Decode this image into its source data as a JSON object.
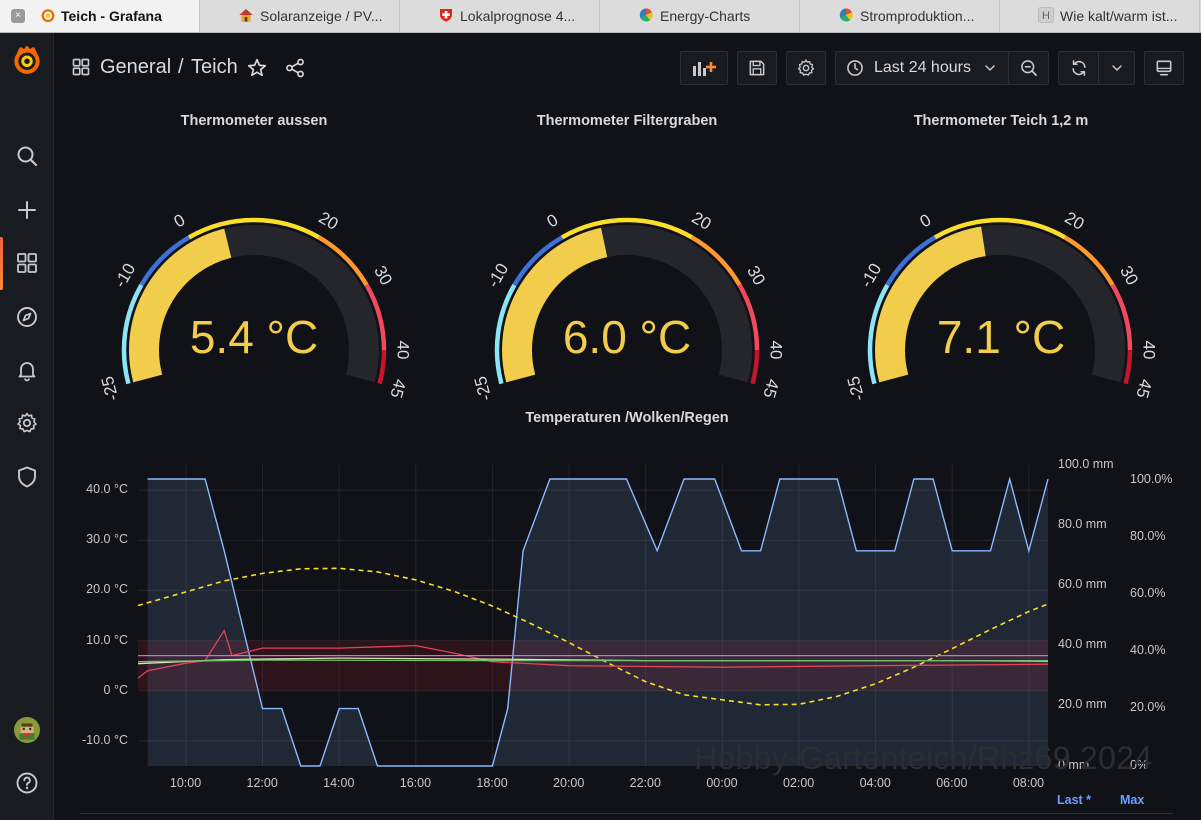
{
  "browser_tabs": [
    {
      "title": "Teich - Grafana",
      "icon": "grafana-icon",
      "active": true
    },
    {
      "title": "Solaranzeige / PV...",
      "icon": "house-icon"
    },
    {
      "title": "Lokalprognose 4...",
      "icon": "swiss-shield-icon"
    },
    {
      "title": "Energy-Charts",
      "icon": "energy-charts-icon"
    },
    {
      "title": "Stromproduktion...",
      "icon": "energy-charts-icon"
    },
    {
      "title": "Wie kalt/warm ist...",
      "icon": "letter-h-icon",
      "icon_text": "H"
    }
  ],
  "sidebar": [
    "grafana-logo-icon",
    "search-icon",
    "plus-icon",
    "dashboards-icon",
    "explore-compass-icon",
    "alerting-bell-icon",
    "settings-gear-icon",
    "shield-icon",
    "user-avatar",
    "help-icon"
  ],
  "breadcrumb": {
    "folder": "General",
    "separator": "/",
    "dashboard": "Teich"
  },
  "toolbar": {
    "time_range": "Last 24 hours"
  },
  "gauges": [
    {
      "title": "Thermometer aussen",
      "value": 5.4,
      "display": "5.4 °C"
    },
    {
      "title": "Thermometer Filtergraben",
      "value": 6.0,
      "display": "6.0 °C"
    },
    {
      "title": "Thermometer Teich 1,2 m",
      "value": 7.1,
      "display": "7.1 °C"
    }
  ],
  "gauge_scale": {
    "min": -25,
    "max": 45,
    "ticks": [
      -25,
      -10,
      0,
      20,
      30,
      40,
      45
    ],
    "thresholds": [
      {
        "from": -25,
        "to": -10,
        "color": "#8ae5f5"
      },
      {
        "from": -10,
        "to": 0,
        "color": "#3d71d9"
      },
      {
        "from": 0,
        "to": 20,
        "color": "#fade2a"
      },
      {
        "from": 20,
        "to": 30,
        "color": "#ff9830"
      },
      {
        "from": 30,
        "to": 40,
        "color": "#f2495c"
      },
      {
        "from": 40,
        "to": 45,
        "color": "#c4162a"
      }
    ],
    "value_color": "#f2cc4b"
  },
  "timeseries": {
    "title": "Temperaturen /Wolken/Regen",
    "left_axis_labels": [
      "40.0 °C",
      "30.0 °C",
      "20.0 °C",
      "10.0 °C",
      "0 °C",
      "-10.0 °C"
    ],
    "right_axis_mm_labels": [
      "100.0 mm",
      "80.0 mm",
      "60.0 mm",
      "40.0 mm",
      "20.0 mm",
      "0 mm"
    ],
    "right_axis_pct_labels": [
      "100.0%",
      "80.0%",
      "60.0%",
      "40.0%",
      "20.0%",
      "0%"
    ],
    "x_labels": [
      "10:00",
      "12:00",
      "14:00",
      "16:00",
      "18:00",
      "20:00",
      "22:00",
      "00:00",
      "02:00",
      "04:00",
      "06:00",
      "08:00"
    ],
    "legend_headers": [
      "Last *",
      "Max"
    ],
    "watermark": "Hobby-Gartenteich/Rhz69 2024"
  },
  "chart_data": {
    "type": "line",
    "title": "Temperaturen /Wolken/Regen",
    "x_unit": "hours (08:45 → 08:45 next day)",
    "x_range": [
      8.75,
      32.5
    ],
    "ylim_left": [
      -15,
      45
    ],
    "ylim_right_pct": [
      0,
      100
    ],
    "ylim_right_mm": [
      0,
      100
    ],
    "grid": true,
    "series": [
      {
        "axis": "right_pct",
        "color": "#8ab8ff",
        "style": "area",
        "points": [
          [
            9,
            100
          ],
          [
            10.5,
            100
          ],
          [
            11,
            75
          ],
          [
            12,
            20
          ],
          [
            12.5,
            20
          ],
          [
            13,
            0
          ],
          [
            13.5,
            0
          ],
          [
            14,
            20
          ],
          [
            14.5,
            20
          ],
          [
            15,
            0
          ],
          [
            18,
            0
          ],
          [
            18.4,
            20
          ],
          [
            18.8,
            75
          ],
          [
            19.5,
            100
          ],
          [
            21.5,
            100
          ],
          [
            22.3,
            75
          ],
          [
            23,
            100
          ],
          [
            23.8,
            100
          ],
          [
            24.5,
            75
          ],
          [
            25,
            75
          ],
          [
            25.5,
            100
          ],
          [
            27,
            100
          ],
          [
            27.5,
            75
          ],
          [
            28.5,
            75
          ],
          [
            29,
            100
          ],
          [
            29.5,
            100
          ],
          [
            30,
            75
          ],
          [
            31,
            75
          ],
          [
            31.5,
            100
          ],
          [
            32,
            75
          ],
          [
            32.5,
            100
          ]
        ]
      },
      {
        "axis": "left",
        "color": "#fade2a",
        "style": "dashed",
        "points": [
          [
            8.75,
            17
          ],
          [
            10,
            19.7
          ],
          [
            11,
            21.9
          ],
          [
            12,
            23.4
          ],
          [
            13,
            24.3
          ],
          [
            14,
            24.4
          ],
          [
            15,
            23.7
          ],
          [
            16,
            22.1
          ],
          [
            17,
            19.8
          ],
          [
            18,
            16.9
          ],
          [
            19,
            13.4
          ],
          [
            20,
            9.6
          ],
          [
            21,
            5.6
          ],
          [
            22,
            1.8
          ],
          [
            23,
            -0.8
          ],
          [
            24,
            -1.8
          ],
          [
            25,
            -2.8
          ],
          [
            26,
            -2.7
          ],
          [
            27,
            -1.1
          ],
          [
            28,
            1.4
          ],
          [
            29,
            4.7
          ],
          [
            30,
            8.4
          ],
          [
            31,
            12.2
          ],
          [
            32,
            15.8
          ],
          [
            32.5,
            17.3
          ]
        ]
      },
      {
        "axis": "left",
        "color": "#e0435a",
        "style": "line",
        "points": [
          [
            8.75,
            2.5
          ],
          [
            9,
            4
          ],
          [
            10,
            5.5
          ],
          [
            10.5,
            6
          ],
          [
            11,
            12
          ],
          [
            11.2,
            7
          ],
          [
            12,
            8.5
          ],
          [
            14,
            8.5
          ],
          [
            16,
            9
          ],
          [
            17,
            7.5
          ],
          [
            18,
            5.8
          ],
          [
            20,
            5
          ],
          [
            24,
            4.7
          ],
          [
            28,
            5
          ],
          [
            32.5,
            5.3
          ]
        ]
      },
      {
        "axis": "left",
        "color": "#b877d9",
        "style": "line",
        "points": [
          [
            8.75,
            7
          ],
          [
            32.5,
            7
          ]
        ]
      },
      {
        "axis": "left",
        "color": "#d6e6b0",
        "style": "line",
        "points": [
          [
            8.75,
            5.4
          ],
          [
            11,
            6.2
          ],
          [
            14,
            6.5
          ],
          [
            18,
            6.3
          ],
          [
            22,
            6.0
          ],
          [
            26,
            6.0
          ],
          [
            30,
            6.0
          ],
          [
            32.5,
            5.9
          ]
        ]
      },
      {
        "axis": "left",
        "color": "#73bf69",
        "style": "line",
        "points": [
          [
            8.75,
            5.8
          ],
          [
            12,
            6.1
          ],
          [
            18,
            6.0
          ],
          [
            24,
            6.0
          ],
          [
            32.5,
            6.0
          ]
        ]
      }
    ]
  }
}
